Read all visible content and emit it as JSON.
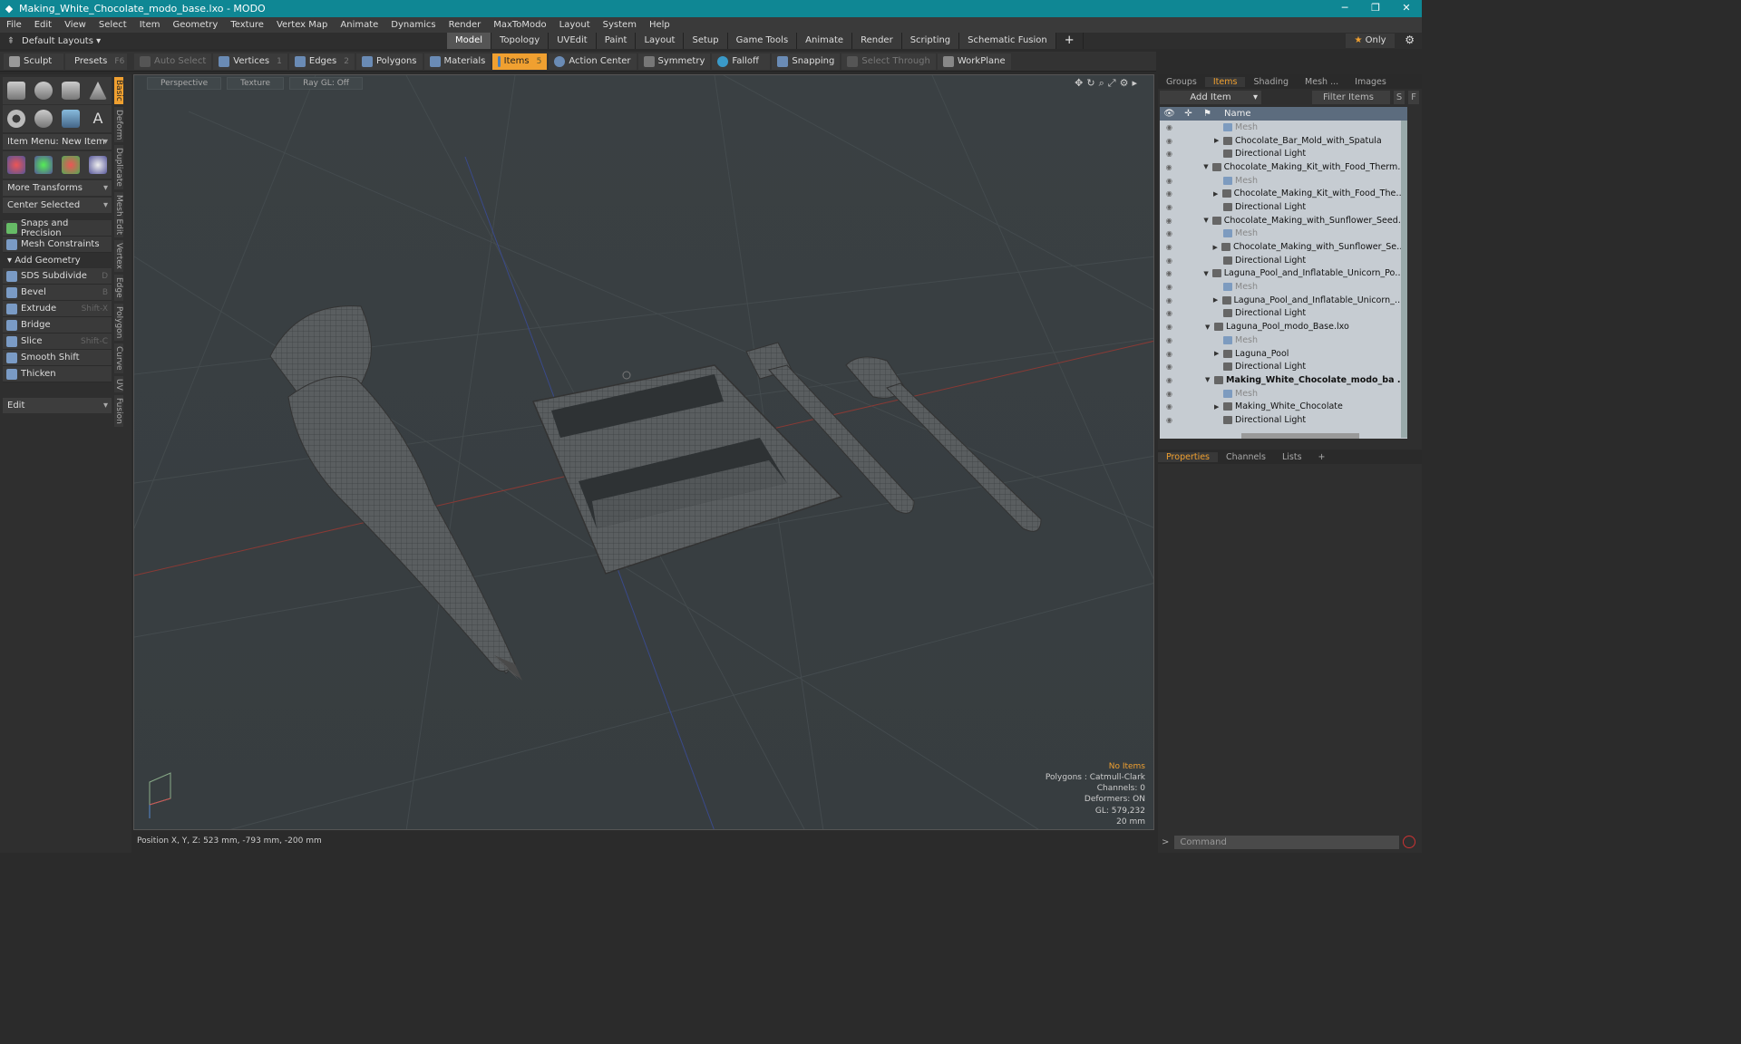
{
  "window": {
    "title": "Making_White_Chocolate_modo_base.lxo - MODO"
  },
  "menu": [
    "File",
    "Edit",
    "View",
    "Select",
    "Item",
    "Geometry",
    "Texture",
    "Vertex Map",
    "Animate",
    "Dynamics",
    "Render",
    "MaxToModo",
    "Layout",
    "System",
    "Help"
  ],
  "layout": {
    "selector": "Default Layouts",
    "only_label": "Only"
  },
  "tabs": [
    "Model",
    "Topology",
    "UVEdit",
    "Paint",
    "Layout",
    "Setup",
    "Game Tools",
    "Animate",
    "Render",
    "Scripting",
    "Schematic Fusion"
  ],
  "toolbar": {
    "sculpt": "Sculpt",
    "presets": "Presets",
    "presets_key": "F6",
    "auto_select": "Auto Select",
    "vertices": "Vertices",
    "vertices_count": "1",
    "edges": "Edges",
    "edges_count": "2",
    "polygons": "Polygons",
    "materials": "Materials",
    "items": "Items",
    "items_count": "5",
    "action_center": "Action Center",
    "symmetry": "Symmetry",
    "falloff": "Falloff",
    "snapping": "Snapping",
    "select_through": "Select Through",
    "workplane": "WorkPlane"
  },
  "left": {
    "item_menu": "Item Menu: New Item",
    "more_transforms": "More Transforms",
    "center_selected": "Center Selected",
    "snaps": "Snaps and Precision",
    "mesh_constraints": "Mesh Constraints",
    "add_geometry": "Add Geometry",
    "tools": [
      {
        "label": "SDS Subdivide",
        "key": "D"
      },
      {
        "label": "Bevel",
        "key": "B"
      },
      {
        "label": "Extrude",
        "key": "Shift-X"
      },
      {
        "label": "Bridge",
        "key": ""
      },
      {
        "label": "Slice",
        "key": "Shift-C"
      },
      {
        "label": "Smooth Shift",
        "key": ""
      },
      {
        "label": "Thicken",
        "key": ""
      }
    ],
    "edit": "Edit",
    "vtabs": [
      "Basic",
      "Deform",
      "Duplicate",
      "Mesh Edit",
      "Vertex",
      "Edge",
      "Polygon",
      "Curve",
      "UV",
      "Fusion"
    ]
  },
  "viewport": {
    "perspective": "Perspective",
    "texture": "Texture",
    "raygl": "Ray GL: Off",
    "info": {
      "no_items": "No Items",
      "polygons": "Polygons : Catmull-Clark",
      "channels": "Channels: 0",
      "deformers": "Deformers: ON",
      "gl": "GL: 579,232",
      "scale": "20 mm"
    }
  },
  "status": {
    "position": "Position X, Y, Z:   523 mm, -793 mm, -200 mm"
  },
  "right": {
    "tabs": [
      "Groups",
      "Items",
      "Shading",
      "Mesh ...",
      "Images"
    ],
    "add_item": "Add Item",
    "filter": "Filter Items",
    "s": "S",
    "f": "F",
    "name_col": "Name",
    "tree": [
      {
        "name": "Mesh",
        "level": 2,
        "type": "mesh",
        "dim": true
      },
      {
        "name": "Chocolate_Bar_Mold_with_Spatula",
        "level": 2,
        "type": "group",
        "arrow": "▶"
      },
      {
        "name": "Directional Light",
        "level": 2,
        "type": "light"
      },
      {
        "name": "Chocolate_Making_Kit_with_Food_Thermo ...",
        "level": 1,
        "type": "scene",
        "arrow": "▼"
      },
      {
        "name": "Mesh",
        "level": 2,
        "type": "mesh",
        "dim": true
      },
      {
        "name": "Chocolate_Making_Kit_with_Food_Ther ...",
        "level": 2,
        "type": "group",
        "arrow": "▶"
      },
      {
        "name": "Directional Light",
        "level": 2,
        "type": "light"
      },
      {
        "name": "Chocolate_Making_with_Sunflower_Seeds ...",
        "level": 1,
        "type": "scene",
        "arrow": "▼"
      },
      {
        "name": "Mesh",
        "level": 2,
        "type": "mesh",
        "dim": true
      },
      {
        "name": "Chocolate_Making_with_Sunflower_Seeds",
        "level": 2,
        "type": "group",
        "arrow": "▶"
      },
      {
        "name": "Directional Light",
        "level": 2,
        "type": "light"
      },
      {
        "name": "Laguna_Pool_and_Inflatable_Unicorn_Pool ...",
        "level": 1,
        "type": "scene",
        "arrow": "▼"
      },
      {
        "name": "Mesh",
        "level": 2,
        "type": "mesh",
        "dim": true
      },
      {
        "name": "Laguna_Pool_and_Inflatable_Unicorn_P ...",
        "level": 2,
        "type": "group",
        "arrow": "▶"
      },
      {
        "name": "Directional Light",
        "level": 2,
        "type": "light"
      },
      {
        "name": "Laguna_Pool_modo_Base.lxo",
        "level": 1,
        "type": "scene",
        "arrow": "▼"
      },
      {
        "name": "Mesh",
        "level": 2,
        "type": "mesh",
        "dim": true
      },
      {
        "name": "Laguna_Pool",
        "level": 2,
        "type": "group",
        "arrow": "▶"
      },
      {
        "name": "Directional Light",
        "level": 2,
        "type": "light"
      },
      {
        "name": "Making_White_Chocolate_modo_ba ...",
        "level": 1,
        "type": "scene",
        "arrow": "▼",
        "bold": true
      },
      {
        "name": "Mesh",
        "level": 2,
        "type": "mesh",
        "dim": true
      },
      {
        "name": "Making_White_Chocolate",
        "level": 2,
        "type": "group",
        "arrow": "▶"
      },
      {
        "name": "Directional Light",
        "level": 2,
        "type": "light"
      }
    ],
    "props_tabs": [
      "Properties",
      "Channels",
      "Lists"
    ],
    "command_placeholder": "Command"
  }
}
